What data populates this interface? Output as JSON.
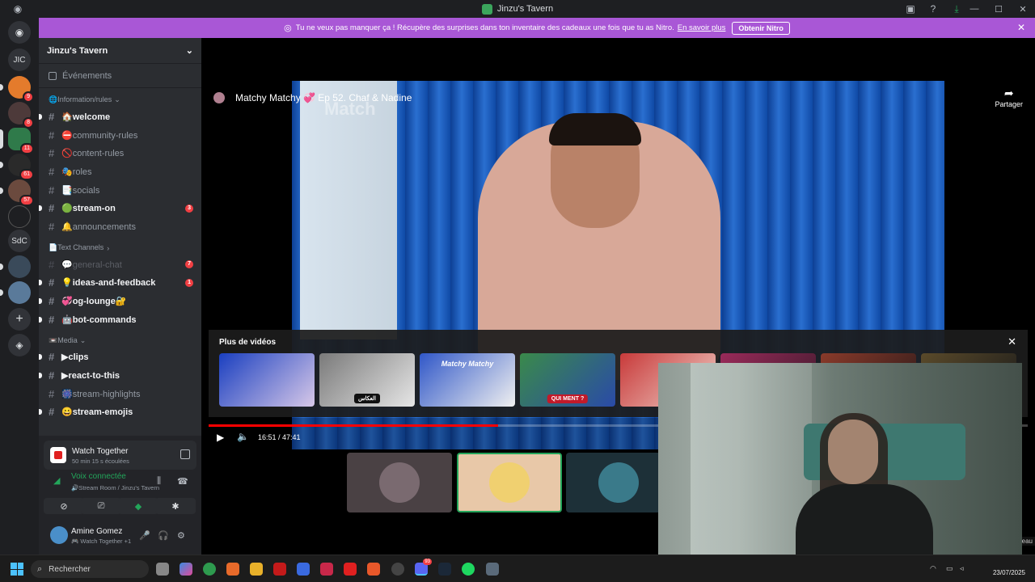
{
  "window": {
    "title": "Jinzu's Tavern",
    "controls": [
      "—",
      "☐",
      "✕"
    ]
  },
  "banner": {
    "text": "Tu ne veux pas manquer ça ! Récupère des surprises dans ton inventaire des cadeaux une fois que tu as Nitro.",
    "link": "En savoir plus",
    "cta": "Obtenir Nitro"
  },
  "rail": {
    "servers": [
      {
        "label": "",
        "badge": ""
      },
      {
        "label": "JIC",
        "badge": ""
      },
      {
        "label": "",
        "badge": "9"
      },
      {
        "label": "",
        "badge": "8"
      },
      {
        "label": "",
        "badge": "11"
      },
      {
        "label": "",
        "badge": "61"
      },
      {
        "label": "",
        "badge": "57"
      },
      {
        "label": "",
        "badge": ""
      },
      {
        "label": "SdC",
        "badge": ""
      },
      {
        "label": "",
        "badge": ""
      },
      {
        "label": "",
        "badge": ""
      }
    ]
  },
  "guild": {
    "name": "Jinzu's Tavern",
    "events": "Événements"
  },
  "categories": {
    "info": "🌐Information/rules",
    "text": "📄Text Channels",
    "media": "📼Media"
  },
  "channels": {
    "welcome": "🏠welcome",
    "community": "⛔community-rules",
    "content": "🚫content-rules",
    "roles": "🎭roles",
    "socials": "📑socials",
    "stream_on": "🟢stream-on",
    "stream_on_count": "3",
    "announcements": "🔔announcements",
    "general": "💬general-chat",
    "general_count": "7",
    "ideas": "💡ideas-and-feedback",
    "ideas_count": "1",
    "og": "💞og-lounge🔐",
    "bot": "🤖bot-commands",
    "clips": "▶clips",
    "react": "▶react-to-this",
    "highlights": "🎆stream-highlights",
    "emojis": "😀stream-emojis"
  },
  "activity": {
    "title": "Watch Together",
    "elapsed": "50 min 15 s écoulées"
  },
  "voice": {
    "status": "Voix connectée",
    "location": "🔊Stream Room / Jinzu's Tavern"
  },
  "user": {
    "name": "Amine Gomez",
    "status": "🎮 Watch Together +1"
  },
  "video": {
    "title": "Matchy Matchy 💞 Ep 52. Chaf & Nadine",
    "watermark": "Match",
    "share": "Partager",
    "more_title": "Plus de vidéos",
    "time": "16:51 / 47:41",
    "progress": 0.353,
    "thumb_label": "QUI MENT ?",
    "thumb_ar": "العكاس",
    "thumb_matchy": "Matchy Matchy",
    "side": "eau"
  },
  "taskbar": {
    "search": "Rechercher",
    "date": "23/07/2025",
    "discord_badge": "93"
  },
  "colors": {
    "brand": "#5865f2",
    "nitro": "#a957d6",
    "online": "#23a55a",
    "mention": "#f23f43",
    "yt_red": "#ff0000"
  }
}
